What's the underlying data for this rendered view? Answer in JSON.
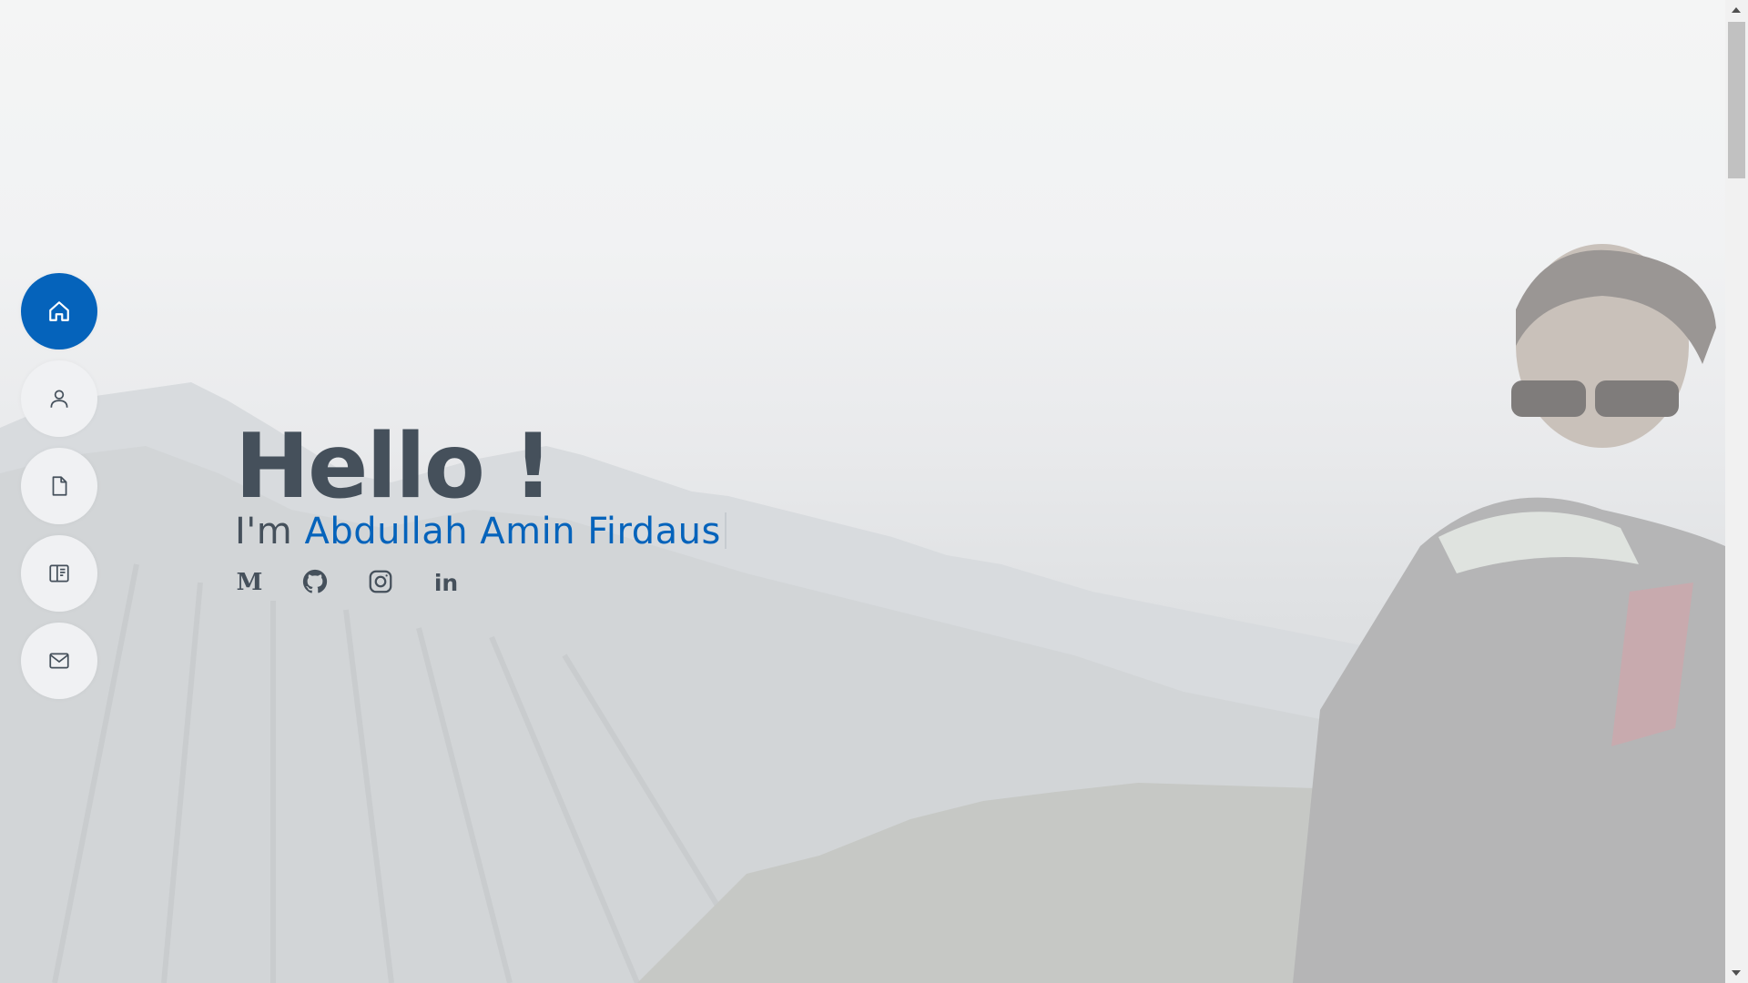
{
  "hero": {
    "greeting": "Hello !",
    "intro_prefix": "I'm ",
    "name": "Abdullah Amin Firdaus"
  },
  "nav": {
    "items": [
      {
        "icon": "home-icon",
        "active": true
      },
      {
        "icon": "person-icon",
        "active": false
      },
      {
        "icon": "file-icon",
        "active": false
      },
      {
        "icon": "book-icon",
        "active": false
      },
      {
        "icon": "envelope-icon",
        "active": false
      }
    ]
  },
  "socials": [
    {
      "icon": "medium-icon",
      "label": "M"
    },
    {
      "icon": "github-icon"
    },
    {
      "icon": "instagram-icon"
    },
    {
      "icon": "linkedin-icon",
      "label": "in"
    }
  ],
  "colors": {
    "accent": "#0563bb",
    "text": "#45505b",
    "nav_bg": "#f0f1f3"
  }
}
